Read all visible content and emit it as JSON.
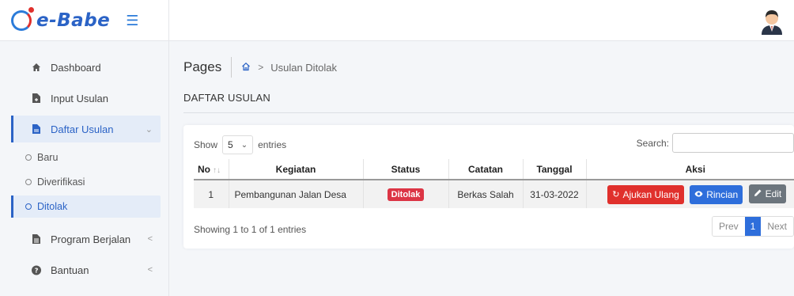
{
  "brand": {
    "name": "e-Babe"
  },
  "sidebar": {
    "items": [
      {
        "label": "Dashboard",
        "icon": "home-icon"
      },
      {
        "label": "Input Usulan",
        "icon": "file-plus-icon"
      },
      {
        "label": "Daftar Usulan",
        "icon": "file-icon",
        "expanded": true
      },
      {
        "label": "Program Berjalan",
        "icon": "file-text-icon"
      },
      {
        "label": "Bantuan",
        "icon": "question-circle-icon"
      }
    ],
    "sub_items": [
      {
        "label": "Baru"
      },
      {
        "label": "Diverifikasi"
      },
      {
        "label": "Ditolak"
      }
    ]
  },
  "breadcrumb": {
    "pages": "Pages",
    "current": "Usulan Ditolak"
  },
  "section": {
    "title": "DAFTAR USULAN"
  },
  "table_controls": {
    "show": "Show",
    "length": "5",
    "entries": "entries",
    "search_label": "Search:",
    "search_value": ""
  },
  "table": {
    "headers": [
      "No",
      "Kegiatan",
      "Status",
      "Catatan",
      "Tanggal",
      "Aksi"
    ],
    "rows": [
      {
        "no": "1",
        "kegiatan": "Pembangunan Jalan Desa",
        "status": "Ditolak",
        "catatan": "Berkas Salah",
        "tanggal": "31-03-2022",
        "actions": {
          "resubmit": "Ajukan Ulang",
          "detail": "Rincian",
          "edit": "Edit"
        }
      }
    ]
  },
  "footer": {
    "info": "Showing 1 to 1 of 1 entries",
    "prev": "Prev",
    "page": "1",
    "next": "Next"
  },
  "colors": {
    "primary": "#2e6edb",
    "danger": "#e0302c",
    "secondary": "#6c757d",
    "brand": "#2b63c6"
  }
}
